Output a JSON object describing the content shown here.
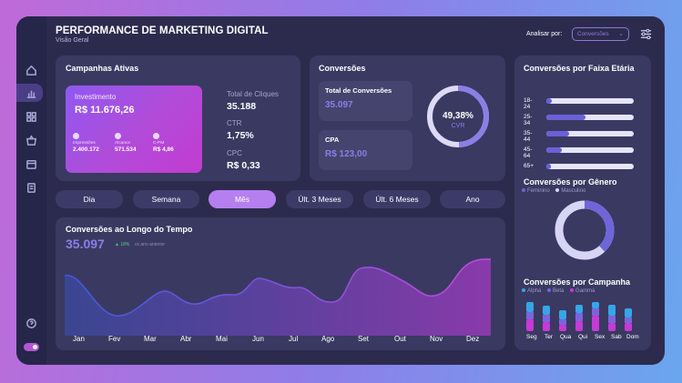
{
  "header": {
    "title": "PERFORMANCE DE MARKETING DIGITAL",
    "subtitle": "Visão Geral",
    "analisar_label": "Analisar por:",
    "analisar_value": "Conversões"
  },
  "campanhas": {
    "title": "Campanhas Ativas",
    "investimento_label": "Investimento",
    "investimento_value": "R$ 11.676,26",
    "mini": [
      {
        "label": "Impressões",
        "value": "2.400.172",
        "icon": "eye-icon"
      },
      {
        "label": "Alcance",
        "value": "571.534",
        "icon": "users-icon"
      },
      {
        "label": "C-PM",
        "value": "R$ 4,86",
        "icon": "dollar-icon"
      }
    ],
    "total_cliques_label": "Total de Cliques",
    "total_cliques_value": "35.188",
    "ctr_label": "CTR",
    "ctr_value": "1,75%",
    "cpc_label": "CPC",
    "cpc_value": "R$ 0,33"
  },
  "conversoes": {
    "title": "Conversões",
    "total_label": "Total de Conversões",
    "total_value": "35.097",
    "cpa_label": "CPA",
    "cpa_value": "R$ 123,00",
    "cvr_value": "49,38%",
    "cvr_label": "CVR",
    "cvr_fraction": 0.4938
  },
  "periods": [
    "Dia",
    "Semana",
    "Mês",
    "Últ. 3 Meses",
    "Últ. 6 Meses",
    "Ano"
  ],
  "active_period": 2,
  "timeline": {
    "title": "Conversões ao Longo do Tempo",
    "value": "35.097",
    "badge": "▲ 18%",
    "badge_note": "vs ano anterior",
    "months": [
      "Jan",
      "Fev",
      "Mar",
      "Abr",
      "Mai",
      "Jun",
      "Jul",
      "Ago",
      "Set",
      "Out",
      "Nov",
      "Dez"
    ]
  },
  "faixa": {
    "title": "Conversões por Faixa Etária",
    "rows": [
      {
        "label": "18-24",
        "fraction": 0.06
      },
      {
        "label": "25-34",
        "fraction": 0.45
      },
      {
        "label": "35-44",
        "fraction": 0.26
      },
      {
        "label": "45-64",
        "fraction": 0.18
      },
      {
        "label": "65+",
        "fraction": 0.05
      }
    ]
  },
  "genero": {
    "title": "Conversões por Gênero",
    "legend": [
      "Feminino",
      "Masculino"
    ],
    "colors": [
      "#6e66d8",
      "#d7d5f6"
    ],
    "feminino_fraction": 0.38
  },
  "campanha": {
    "title": "Conversões por Campanha",
    "legend": [
      "Alpha",
      "Beta",
      "Gamma"
    ],
    "colors": [
      "#35a6e8",
      "#7c64dc",
      "#c63ad6"
    ],
    "days": [
      "Seg",
      "Ter",
      "Qua",
      "Qui",
      "Sex",
      "Sab",
      "Dom"
    ]
  },
  "colors": {
    "accent": "#b67ff0",
    "card": "#3a3962",
    "background": "#2c2b4d"
  }
}
